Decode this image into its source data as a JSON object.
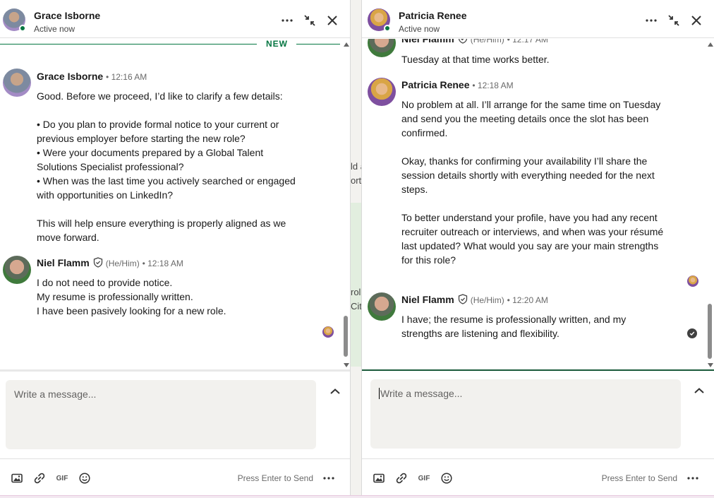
{
  "colors": {
    "accent_green": "#057642",
    "text": "#191919",
    "meta": "#666666",
    "compose_bg": "#f2f1ee"
  },
  "background_fragments": {
    "top": [
      "ld a",
      "ort"
    ],
    "bottom": [
      "rol",
      "City"
    ]
  },
  "left_chat": {
    "header": {
      "name": "Grace Isborne",
      "status": "Active now"
    },
    "new_divider": "NEW",
    "messages": [
      {
        "sender": "Grace Isborne",
        "time": "• 12:16 AM",
        "lines": [
          "Good. Before we proceed, I’d like to clarify a few details:",
          "",
          "• Do you plan to provide formal notice to your current or",
          "previous employer before starting the new role?",
          "• Were your documents prepared by a Global Talent",
          "Solutions Specialist professional?",
          "• When was the last time you actively searched or engaged",
          "with opportunities on LinkedIn?",
          "",
          "This will help ensure everything is properly aligned as we",
          "move forward."
        ]
      },
      {
        "sender": "Niel Flamm",
        "pronouns": "(He/Him)",
        "time": "• 12:18 AM",
        "lines": [
          "I do not need to provide notice.",
          "My resume is professionally written.",
          "I have been pasively looking for a new role."
        ]
      }
    ],
    "compose": {
      "placeholder": "Write a message..."
    },
    "footer": {
      "send_hint": "Press Enter to Send",
      "gif_label": "GIF"
    }
  },
  "right_chat": {
    "header": {
      "name": "Patricia Renee",
      "status": "Active now"
    },
    "messages": [
      {
        "sender": "Niel Flamm",
        "pronouns": "(He/Him)",
        "time": "• 12:17 AM",
        "lines": [
          "Tuesday at that time works better."
        ]
      },
      {
        "sender": "Patricia Renee",
        "time": "• 12:18 AM",
        "lines": [
          "No problem at all. I’ll arrange for the same time on Tuesday",
          "and send you the meeting details once the slot has been",
          "confirmed.",
          "",
          "Okay, thanks for confirming your availability I’ll share the",
          "session details shortly with everything needed for the next",
          "steps.",
          "",
          "To better understand your profile, have you had any recent",
          "recruiter outreach or interviews, and when was your résumé",
          "last updated? What would you say are your main strengths",
          "for this role?"
        ]
      },
      {
        "sender": "Niel Flamm",
        "pronouns": "(He/Him)",
        "time": "• 12:20 AM",
        "lines": [
          "I have; the resume is professionally written, and my",
          "strengths are listening and flexibility."
        ]
      }
    ],
    "compose": {
      "placeholder": "Write a message..."
    },
    "footer": {
      "send_hint": "Press Enter to Send",
      "gif_label": "GIF"
    }
  },
  "icons": {
    "header": [
      "more-icon",
      "minimize-icon",
      "close-icon"
    ],
    "footer": [
      "image-icon",
      "link-icon",
      "gif-icon",
      "emoji-icon",
      "more-icon"
    ],
    "compose": "chevron-up-icon",
    "badge": "verified-shield-icon"
  }
}
